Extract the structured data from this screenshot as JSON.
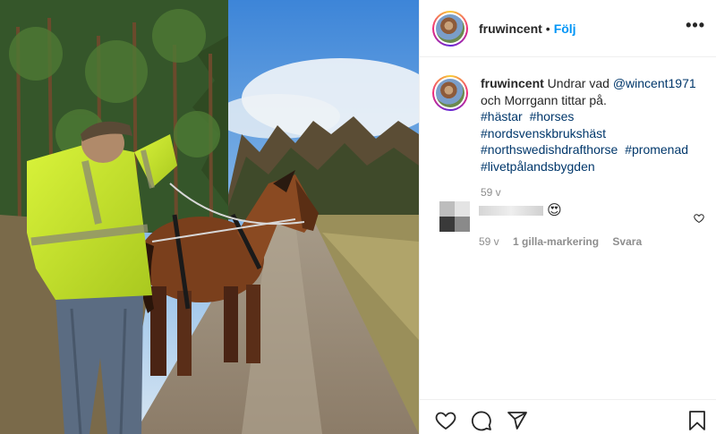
{
  "post": {
    "username": "fruwincent",
    "separator": "•",
    "follow_label": "Följ",
    "more_label": "•••"
  },
  "caption": {
    "username": "fruwincent",
    "text_before": "Undrar vad",
    "mention": "@wincent1971",
    "text_after": "och Morrgann tittar på.",
    "hashtags": [
      "#hästar",
      "#horses",
      "#nordsvenskbrukshäst",
      "#northswedishdrafthorse",
      "#promenad",
      "#livetpålandsbygden"
    ],
    "time": "59 v"
  },
  "reply": {
    "emoji": "😍",
    "time": "59 v",
    "likes": "1 gilla-markering",
    "reply_label": "Svara"
  },
  "icons": {
    "like": "heart-icon",
    "comment": "comment-icon",
    "share": "share-icon",
    "save": "bookmark-icon",
    "reply_like": "heart-icon"
  },
  "colors": {
    "link": "#00376b",
    "follow": "#0095f6",
    "meta": "#8e8e8e",
    "text": "#262626"
  }
}
